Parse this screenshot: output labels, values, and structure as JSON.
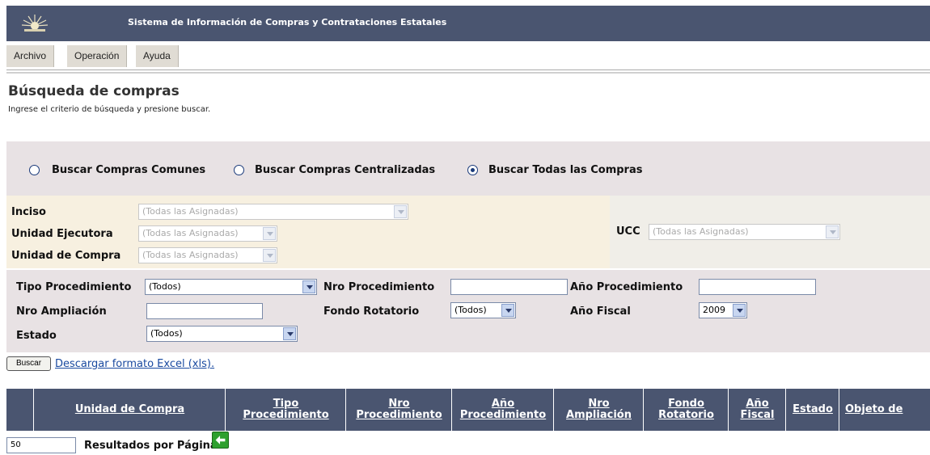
{
  "app": {
    "title": "Sistema de Información de Compras y Contrataciones Estatales"
  },
  "menu": [
    "Archivo",
    "Operación",
    "Ayuda"
  ],
  "page": {
    "title": "Búsqueda de compras",
    "subtitle": "Ingrese el criterio de búsqueda y presione buscar."
  },
  "search_type": {
    "options": [
      "Buscar Compras Comunes",
      "Buscar Compras Centralizadas",
      "Buscar Todas las Compras"
    ],
    "selected": "Buscar Todas las Compras"
  },
  "org": {
    "inciso_label": "Inciso",
    "inciso_value": "(Todas las Asignadas)",
    "unidad_ejecutora_label": "Unidad Ejecutora",
    "unidad_ejecutora_value": "(Todas las Asignadas)",
    "unidad_compra_label": "Unidad de Compra",
    "unidad_compra_value": "(Todas las Asignadas)",
    "ucc_label": "UCC",
    "ucc_value": "(Todas las Asignadas)"
  },
  "filters": {
    "tipo_procedimiento_label": "Tipo Procedimiento",
    "tipo_procedimiento_value": "(Todos)",
    "nro_procedimiento_label": "Nro Procedimiento",
    "nro_procedimiento_value": "",
    "anio_procedimiento_label": "Año Procedimiento",
    "anio_procedimiento_value": "",
    "nro_ampliacion_label": "Nro Ampliación",
    "nro_ampliacion_value": "",
    "fondo_rotatorio_label": "Fondo Rotatorio",
    "fondo_rotatorio_value": "(Todos)",
    "anio_fiscal_label": "Año Fiscal",
    "anio_fiscal_value": "2009",
    "estado_label": "Estado",
    "estado_value": "(Todos)"
  },
  "actions": {
    "buscar_label": "Buscar",
    "excel_label": "Descargar formato Excel (xls)."
  },
  "results": {
    "columns": [
      [
        "Unidad de Compra"
      ],
      [
        "Tipo",
        "Procedimiento"
      ],
      [
        "Nro",
        "Procedimiento"
      ],
      [
        "Año",
        "Procedimiento"
      ],
      [
        "Nro",
        "Ampliación"
      ],
      [
        "Fondo",
        "Rotatorio"
      ],
      [
        "Año",
        "Fiscal"
      ],
      [
        "Estado"
      ],
      [
        "Objeto de"
      ]
    ],
    "per_page_value": "50",
    "per_page_label": "Resultados por Página"
  },
  "icons": {
    "logo": "sun-emblem-icon",
    "back": "arrow-left-icon"
  },
  "colors": {
    "header": "#4a5570",
    "link": "#1a4aa0",
    "back_icon": "#2ea02e"
  }
}
